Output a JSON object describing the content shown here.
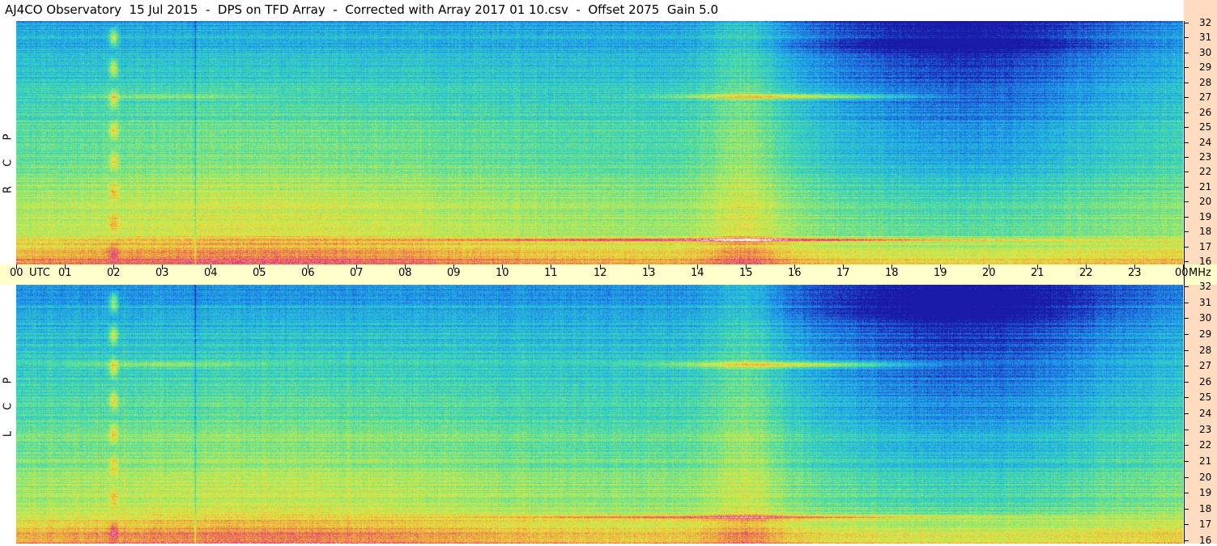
{
  "title": "AJ4CO Observatory  15 Jul 2015  -  DPS on TFD Array  -  Corrected with Array 2017 01 10.csv  -  Offset 2075  Gain 5.0",
  "panels": [
    {
      "name": "rcp",
      "letters": [
        "P",
        "C",
        "R"
      ]
    },
    {
      "name": "lcp",
      "letters": [
        "P",
        "C",
        "L"
      ]
    }
  ],
  "time_axis": {
    "labels": [
      "00",
      "UTC",
      "01",
      "02",
      "03",
      "04",
      "05",
      "06",
      "07",
      "08",
      "09",
      "10",
      "11",
      "12",
      "13",
      "14",
      "15",
      "16",
      "17",
      "18",
      "19",
      "20",
      "21",
      "22",
      "23",
      "00",
      "MHz"
    ]
  },
  "colors": {
    "mid_band": "#ffffcc",
    "right_strip": "#ffdcc0"
  },
  "chart_data": {
    "type": "heatmap",
    "title": "AJ4CO Observatory  15 Jul 2015  -  DPS on TFD Array  -  Corrected with Array 2017 01 10.csv  -  Offset 2075  Gain 5.0",
    "xlabel": "UTC",
    "ylabel": "MHz",
    "x_range_hours": [
      0,
      24
    ],
    "x_ticks": [
      "00",
      "01",
      "02",
      "03",
      "04",
      "05",
      "06",
      "07",
      "08",
      "09",
      "10",
      "11",
      "12",
      "13",
      "14",
      "15",
      "16",
      "17",
      "18",
      "19",
      "20",
      "21",
      "22",
      "23",
      "00"
    ],
    "y_range_mhz": [
      16,
      32
    ],
    "y_ticks": [
      "16",
      "17",
      "18",
      "19",
      "20",
      "21",
      "22",
      "23",
      "24",
      "25",
      "26",
      "27",
      "28",
      "29",
      "30",
      "31",
      "32"
    ],
    "panels": [
      "RCP",
      "LCP"
    ],
    "colormap": [
      "#1a1aa8",
      "#1e6fe0",
      "#21b3e6",
      "#40d8b0",
      "#9be86a",
      "#e6e640",
      "#f0a040",
      "#e0307a",
      "#ffffff"
    ]
  }
}
